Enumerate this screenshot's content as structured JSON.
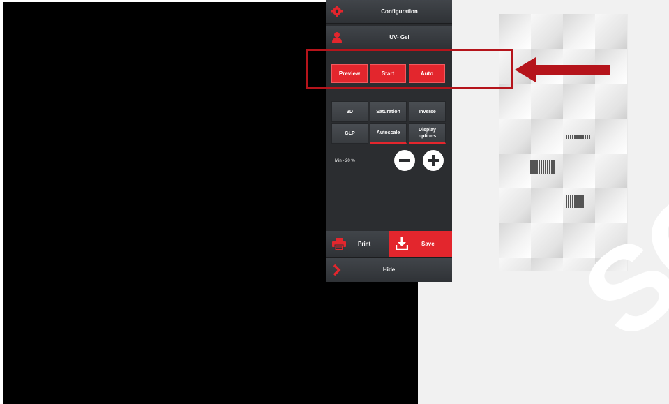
{
  "panel": {
    "configuration_label": "Configuration",
    "profile_label": "UV- Gel",
    "action_buttons": [
      {
        "label": "Preview"
      },
      {
        "label": "Start"
      },
      {
        "label": "Auto"
      }
    ],
    "options": [
      {
        "label": "3D"
      },
      {
        "label": "Saturation"
      },
      {
        "label": "Inverse"
      },
      {
        "label": "GLP"
      },
      {
        "label": "Autoscale"
      },
      {
        "label": "Display\noptions"
      }
    ],
    "min_label": "Min - 20 %",
    "print_label": "Print",
    "save_label": "Save",
    "hide_label": "Hide"
  },
  "icons": {
    "configuration": "gear-icon",
    "profile": "user-icon",
    "minus": "minus-circle-icon",
    "plus": "plus-circle-icon",
    "print": "printer-icon",
    "save": "download-icon",
    "hide": "chevron-right-icon"
  },
  "colors": {
    "accent_red": "#e3262d",
    "panel_bg": "#2b2d30",
    "annotation_red": "#b5141b"
  },
  "watermark": "SC"
}
